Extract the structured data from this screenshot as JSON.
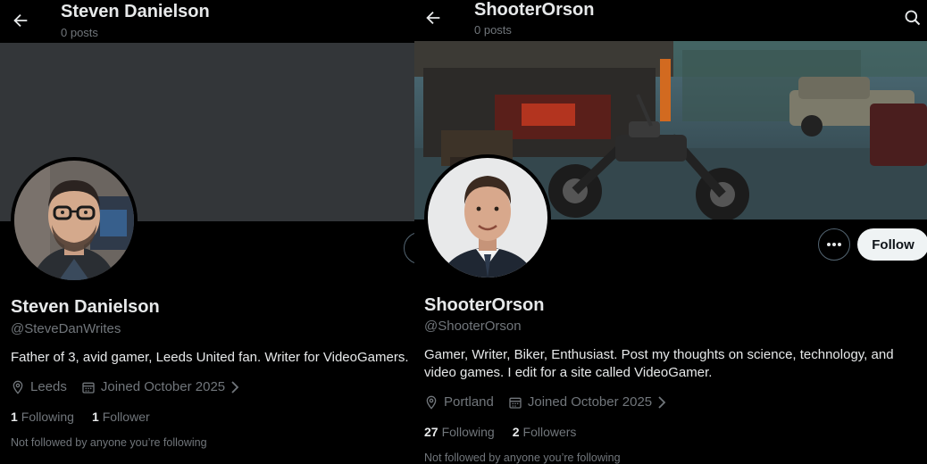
{
  "left": {
    "header": {
      "name": "Steven Danielson",
      "posts": "0 posts"
    },
    "profile": {
      "name": "Steven Danielson",
      "handle": "@SteveDanWrites",
      "bio": "Father of 3, avid gamer, Leeds United fan. Writer for VideoGamers.",
      "location": "Leeds",
      "joined": "Joined October 2025",
      "following_count": "1",
      "following_label": "Following",
      "followers_count": "1",
      "followers_label": "Follower",
      "not_followed": "Not followed by anyone you’re following"
    }
  },
  "right": {
    "header": {
      "name": "ShooterOrson",
      "posts": "0 posts"
    },
    "profile": {
      "name": "ShooterOrson",
      "handle": "@ShooterOrson",
      "bio": "Gamer, Writer, Biker, Enthusiast. Post my thoughts on science, technology, and video games. I edit for a site called VideoGamer.",
      "location": "Portland",
      "joined": "Joined October 2025",
      "following_count": "27",
      "following_label": "Following",
      "followers_count": "2",
      "followers_label": "Followers",
      "not_followed": "Not followed by anyone you’re following"
    },
    "actions": {
      "follow_label": "Follow"
    }
  },
  "colors": {
    "background": "#000000",
    "text_primary": "#e7e9ea",
    "text_secondary": "#71767b",
    "banner_placeholder": "#333639",
    "follow_button": "#eff3f4"
  },
  "icons": [
    "back-arrow-icon",
    "search-icon",
    "location-pin-icon",
    "calendar-icon",
    "chevron-right-icon",
    "more-dots-icon"
  ]
}
